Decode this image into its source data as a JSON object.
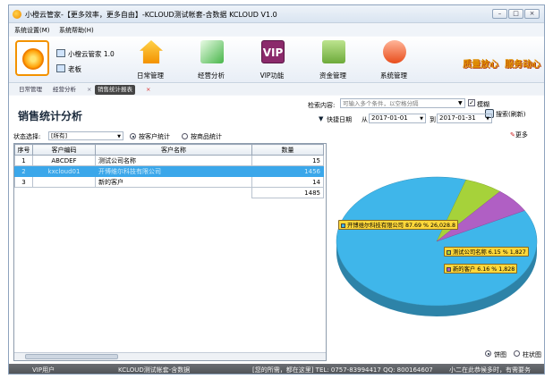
{
  "window": {
    "title": "小橙云管家-【更多效率，更多自由】-KCLOUD测试帐套-含数据  KCLOUD V1.0"
  },
  "menu": [
    {
      "label": "系统设置(M)"
    },
    {
      "label": "系统帮助(H)"
    }
  ],
  "brand": {
    "name": "小橙云管家 1.0",
    "user": "老板"
  },
  "toolbar": [
    {
      "label": "日常管理",
      "icon": "home-icon"
    },
    {
      "label": "经营分析",
      "icon": "trend-chart-icon"
    },
    {
      "label": "VIP功能",
      "icon": "vip-icon"
    },
    {
      "label": "资金管理",
      "icon": "money-icon"
    },
    {
      "label": "系统管理",
      "icon": "system-icon"
    }
  ],
  "vip_text": "VIP",
  "slogans": [
    "质量放心",
    "服务动心"
  ],
  "tabs": [
    {
      "label": "日常管理"
    },
    {
      "label": "经营分析"
    },
    {
      "label": "销售统计报表"
    }
  ],
  "tab_close": "×",
  "page": {
    "title": "销售统计分析"
  },
  "search": {
    "label": "检索内容:",
    "placeholder": "可输入多个条件，以空格分隔",
    "fuzzy_label": "模糊",
    "button": "搜索(刷新)"
  },
  "date": {
    "quick_label": "快捷日期",
    "from_label": "从",
    "from": "2017-01-01",
    "to_label": "到",
    "to": "2017-01-31"
  },
  "more": "更多",
  "filter": {
    "status_label": "状态选择:",
    "status_value": "[所有]",
    "by_customer": "按客户统计",
    "by_product": "按商品统计"
  },
  "table": {
    "columns": [
      "序号",
      "客户编码",
      "客户名称",
      "数量"
    ],
    "rows": [
      [
        "1",
        "ABCDEF",
        "测试公司名称",
        "15"
      ],
      [
        "2",
        "kxcloud01",
        "开博维尔科技有限公司",
        "1456"
      ],
      [
        "3",
        "",
        "新的客户",
        "14"
      ]
    ],
    "total": "1485"
  },
  "chart_data": {
    "type": "pie",
    "labels": [
      "开博维尔科技有限公司 87.69 % 26,028.8",
      "测试公司名称 6.15 % 1,827",
      "新的客户 6.16 % 1,828"
    ],
    "series": [
      {
        "name": "开博维尔科技有限公司",
        "percent": 87.69,
        "value": 26028.8,
        "color": "#3fb6ea"
      },
      {
        "name": "测试公司名称",
        "percent": 6.15,
        "value": 1827,
        "color": "#a6d23a"
      },
      {
        "name": "新的客户",
        "percent": 6.16,
        "value": 1828,
        "color": "#b05fc4"
      }
    ]
  },
  "chart_type": {
    "pie": "饼图",
    "bar": "柱状图"
  },
  "statusbar": [
    "VIP用户",
    "KCLOUD测试帐套-含数据",
    "[您的所需，都在这里]  TEL: 0757-83994417  QQ: 800164607",
    "小二在此恭候多时，有需要务"
  ]
}
